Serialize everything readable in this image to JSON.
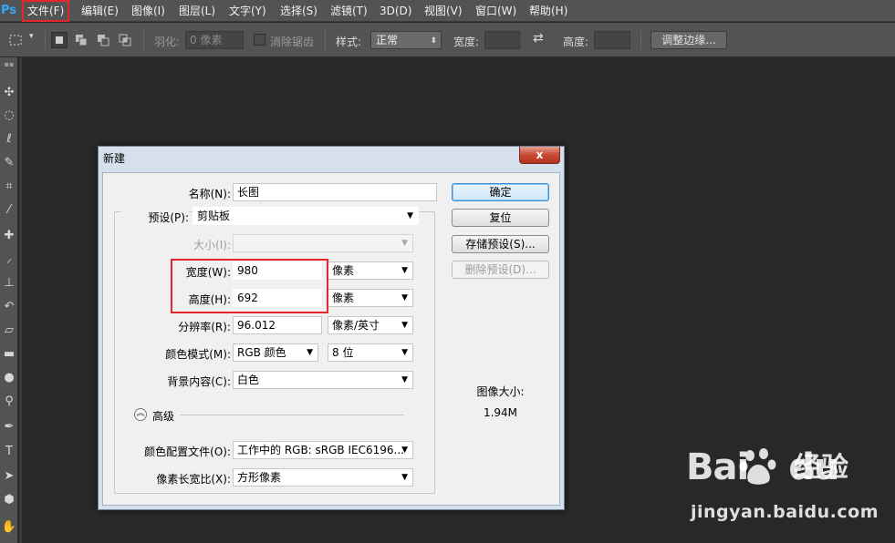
{
  "app": {
    "logo": "Ps"
  },
  "menu": [
    {
      "label": "文件(F)",
      "name": "menu-file",
      "highlighted": true
    },
    {
      "label": "编辑(E)",
      "name": "menu-edit"
    },
    {
      "label": "图像(I)",
      "name": "menu-image"
    },
    {
      "label": "图层(L)",
      "name": "menu-layer"
    },
    {
      "label": "文字(Y)",
      "name": "menu-type"
    },
    {
      "label": "选择(S)",
      "name": "menu-select"
    },
    {
      "label": "滤镜(T)",
      "name": "menu-filter"
    },
    {
      "label": "3D(D)",
      "name": "menu-3d"
    },
    {
      "label": "视图(V)",
      "name": "menu-view"
    },
    {
      "label": "窗口(W)",
      "name": "menu-window"
    },
    {
      "label": "帮助(H)",
      "name": "menu-help"
    }
  ],
  "options": {
    "feather_label": "羽化:",
    "feather_value": "0 像素",
    "antialias_label": "消除锯齿",
    "style_label": "样式:",
    "style_value": "正常",
    "width_label": "宽度:",
    "height_label": "高度:",
    "refine_edge": "调整边缘..."
  },
  "tools": [
    "move-tool-icon",
    "marquee-tool-icon",
    "lasso-tool-icon",
    "quick-select-tool-icon",
    "crop-tool-icon",
    "eyedropper-tool-icon",
    "healing-tool-icon",
    "brush-tool-icon",
    "stamp-tool-icon",
    "history-brush-tool-icon",
    "eraser-tool-icon",
    "gradient-tool-icon",
    "blur-tool-icon",
    "dodge-tool-icon",
    "pen-tool-icon",
    "type-tool-icon",
    "path-select-tool-icon",
    "shape-tool-icon",
    "hand-tool-icon"
  ],
  "dialog": {
    "title": "新建",
    "close": "x",
    "name_label": "名称(N):",
    "name_value": "长图",
    "preset_label": "预设(P):",
    "preset_value": "剪贴板",
    "size_label": "大小(I):",
    "size_value": "",
    "width_label": "宽度(W):",
    "width_value": "980",
    "width_unit": "像素",
    "height_label": "高度(H):",
    "height_value": "692",
    "height_unit": "像素",
    "resolution_label": "分辨率(R):",
    "resolution_value": "96.012",
    "resolution_unit": "像素/英寸",
    "color_mode_label": "颜色模式(M):",
    "color_mode_value": "RGB 颜色",
    "bit_depth_value": "8 位",
    "background_label": "背景内容(C):",
    "background_value": "白色",
    "advanced_label": "高级",
    "color_profile_label": "颜色配置文件(O):",
    "color_profile_value": "工作中的 RGB: sRGB IEC6196...",
    "pixel_aspect_label": "像素长宽比(X):",
    "pixel_aspect_value": "方形像素",
    "ok_button": "确定",
    "reset_button": "复位",
    "save_preset_button": "存储预设(S)...",
    "delete_preset_button": "删除预设(D)...",
    "image_size_label": "图像大小:",
    "image_size_value": "1.94M"
  },
  "watermark": {
    "logo_text": "Bai",
    "logo_text_end": "du",
    "cn_text": "经验",
    "url": "jingyan.baidu.com"
  },
  "colors": {
    "highlight_red": "#e8262a",
    "ps_blue": "#31a8ff",
    "canvas_bg": "#282828"
  }
}
